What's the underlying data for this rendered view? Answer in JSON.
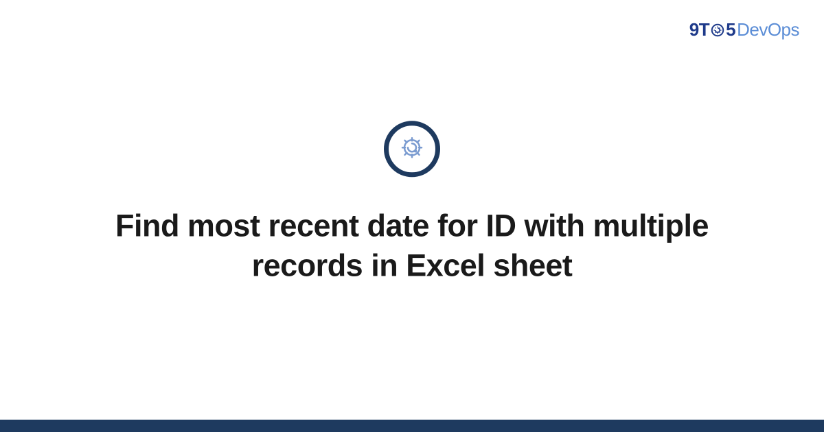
{
  "logo": {
    "nine": "9",
    "t": "T",
    "five": "5",
    "devops": "DevOps"
  },
  "title": "Find most recent date for ID with multiple records in Excel sheet",
  "colors": {
    "darkBlue": "#1e3a5f",
    "lightBlue": "#5b8dd6",
    "navyBlue": "#1e3a8a"
  }
}
